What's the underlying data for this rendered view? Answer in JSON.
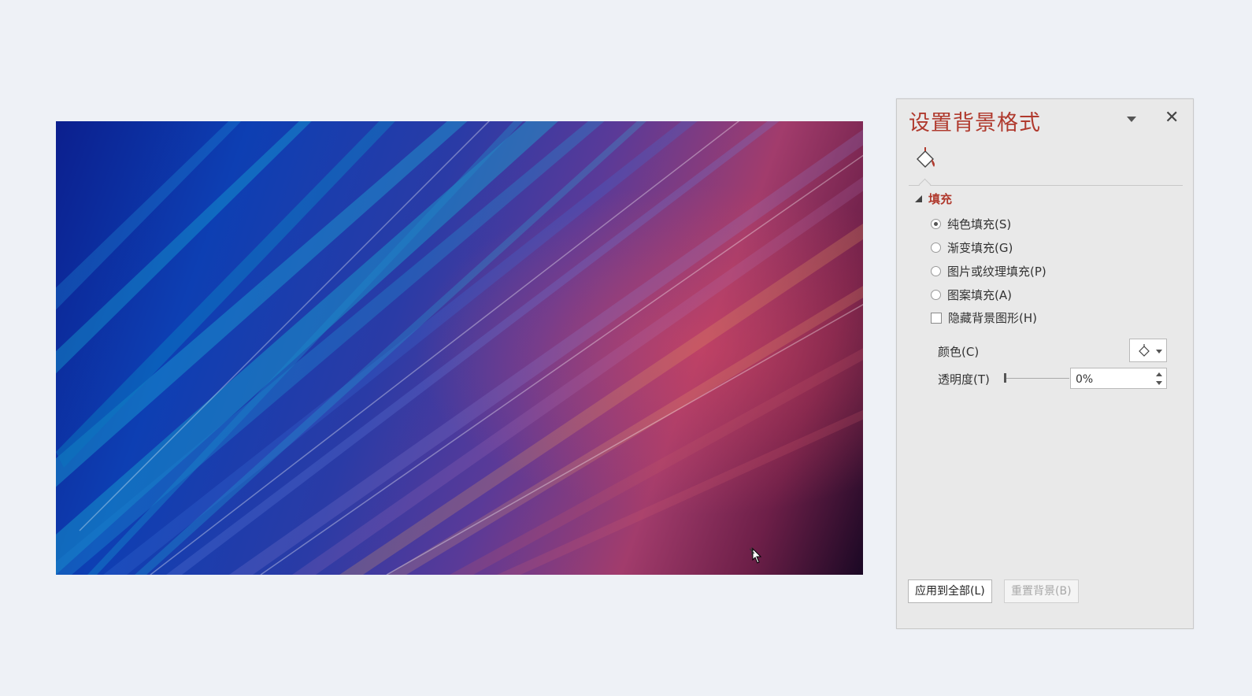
{
  "panel": {
    "title": "设置背景格式",
    "close_glyph": "✕",
    "tab_icon": "paint-bucket-icon",
    "section": {
      "label": "填充",
      "expanded": true
    },
    "options": [
      {
        "label": "纯色填充(S)",
        "selected": true
      },
      {
        "label": "渐变填充(G)",
        "selected": false
      },
      {
        "label": "图片或纹理填充(P)",
        "selected": false
      },
      {
        "label": "图案填充(A)",
        "selected": false
      }
    ],
    "hide_graphics": {
      "label": "隐藏背景图形(H)",
      "checked": false
    },
    "color": {
      "label": "颜色(C)"
    },
    "transparency": {
      "label": "透明度(T)",
      "value": "0%",
      "slider_fraction": 0
    },
    "buttons": {
      "apply_all": "应用到全部(L)",
      "reset": "重置背景(B)"
    }
  },
  "slide": {
    "background": "abstract blue-purple-red streak image"
  },
  "colors": {
    "accent": "#b03a2e",
    "page_bg": "#eef1f6",
    "panel_bg": "#e9e9e9"
  }
}
